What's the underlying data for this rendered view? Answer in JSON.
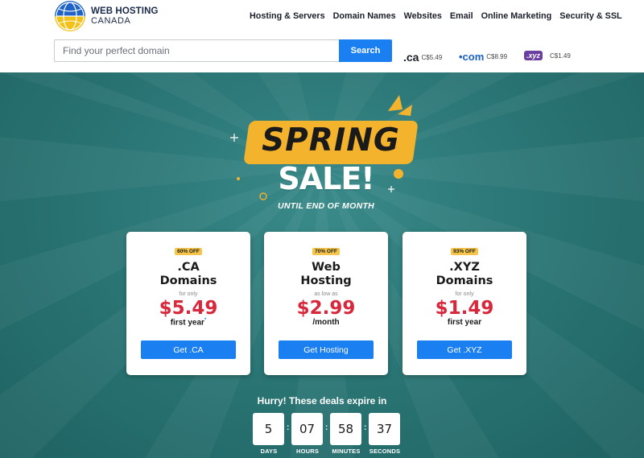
{
  "brand": {
    "line1": "WEB HOSTING",
    "line2": "CANADA",
    "icon": "globe-icon"
  },
  "nav": [
    "Hosting & Servers",
    "Domain Names",
    "Websites",
    "Email",
    "Online Marketing",
    "Security & SSL"
  ],
  "search": {
    "placeholder": "Find your perfect domain",
    "value": "",
    "button_label": "Search"
  },
  "tld_prices": [
    {
      "ext": ".ca",
      "price": "C$5.49"
    },
    {
      "ext": "•com",
      "price": "C$8.99"
    },
    {
      "ext": ".xyz",
      "price": "C$1.49"
    }
  ],
  "hero": {
    "headline": "SPRING",
    "headline2": "SALE!",
    "subline": "UNTIL END OF MONTH"
  },
  "cards": [
    {
      "badge": "60% OFF",
      "title_l1": ".CA",
      "title_l2": "Domains",
      "sub": "for only",
      "price": "$5.49",
      "period": "first year",
      "period_mark": "*",
      "button": "Get .CA"
    },
    {
      "badge": "70% OFF",
      "title_l1": "Web",
      "title_l2": "Hosting",
      "sub": "as low as",
      "price": "$2.99",
      "period": "/month",
      "period_mark": "",
      "button": "Get Hosting"
    },
    {
      "badge": "93% OFF",
      "title_l1": ".XYZ",
      "title_l2": "Domains",
      "sub": "for only",
      "price": "$1.49",
      "period": "first year",
      "period_mark": "",
      "button": "Get .XYZ"
    }
  ],
  "countdown": {
    "heading": "Hurry! These deals expire in",
    "units": [
      {
        "value": "5",
        "label": "DAYS"
      },
      {
        "value": "07",
        "label": "HOURS"
      },
      {
        "value": "58",
        "label": "MINUTES"
      },
      {
        "value": "37",
        "label": "SECONDS"
      }
    ],
    "separator": ":"
  },
  "colors": {
    "accent": "#1a7ff0",
    "price": "#d8283c",
    "hero_bg": "#2b7676",
    "badge": "#f4b32c"
  }
}
